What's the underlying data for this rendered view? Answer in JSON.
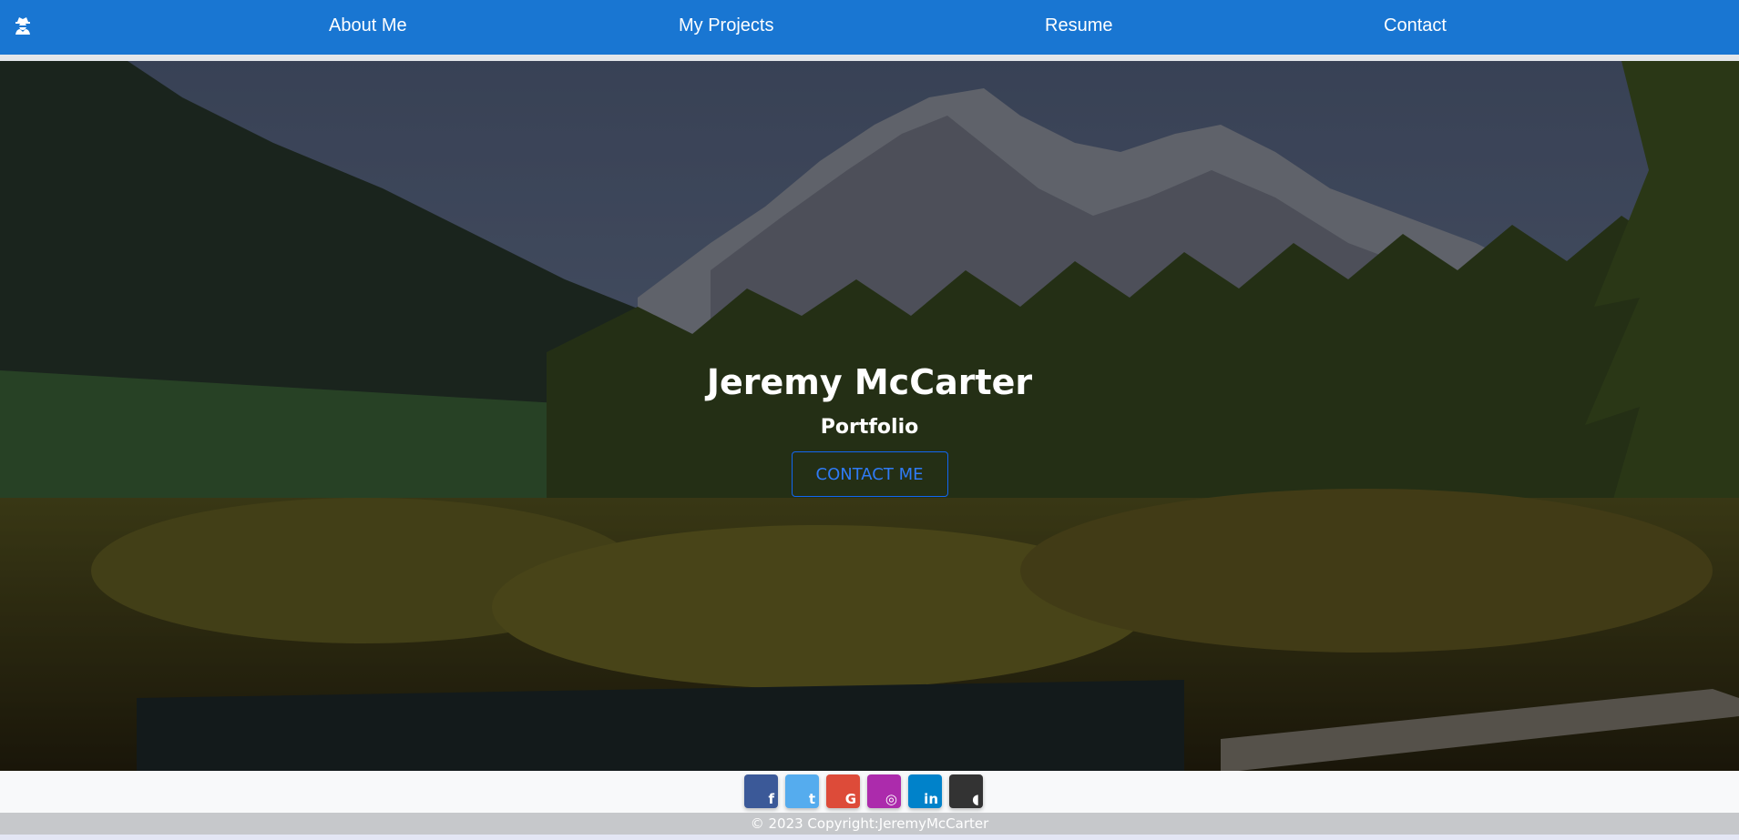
{
  "nav": {
    "brand_icon": "user-secret-icon",
    "links": [
      "About Me",
      "My Projects",
      "Resume",
      "Contact"
    ]
  },
  "hero": {
    "title": "Jeremy McCarter",
    "subtitle": "Portfolio",
    "button_label": "CONTACT ME"
  },
  "footer": {
    "social": [
      {
        "name": "facebook-icon",
        "glyph": "f",
        "color": "#3b5998"
      },
      {
        "name": "twitter-icon",
        "glyph": "t",
        "color": "#55acee"
      },
      {
        "name": "google-icon",
        "glyph": "G",
        "color": "#dd4b39"
      },
      {
        "name": "instagram-icon",
        "glyph": "◎",
        "color": "#ac2bac"
      },
      {
        "name": "linkedin-icon",
        "glyph": "in",
        "color": "#0082ca"
      },
      {
        "name": "github-icon",
        "glyph": "◖",
        "color": "#333333"
      }
    ],
    "copyright": "© 2023 Copyright:JeremyMcCarter"
  },
  "colors": {
    "navbar": "#1976d2",
    "button_accent": "#1266f1"
  }
}
